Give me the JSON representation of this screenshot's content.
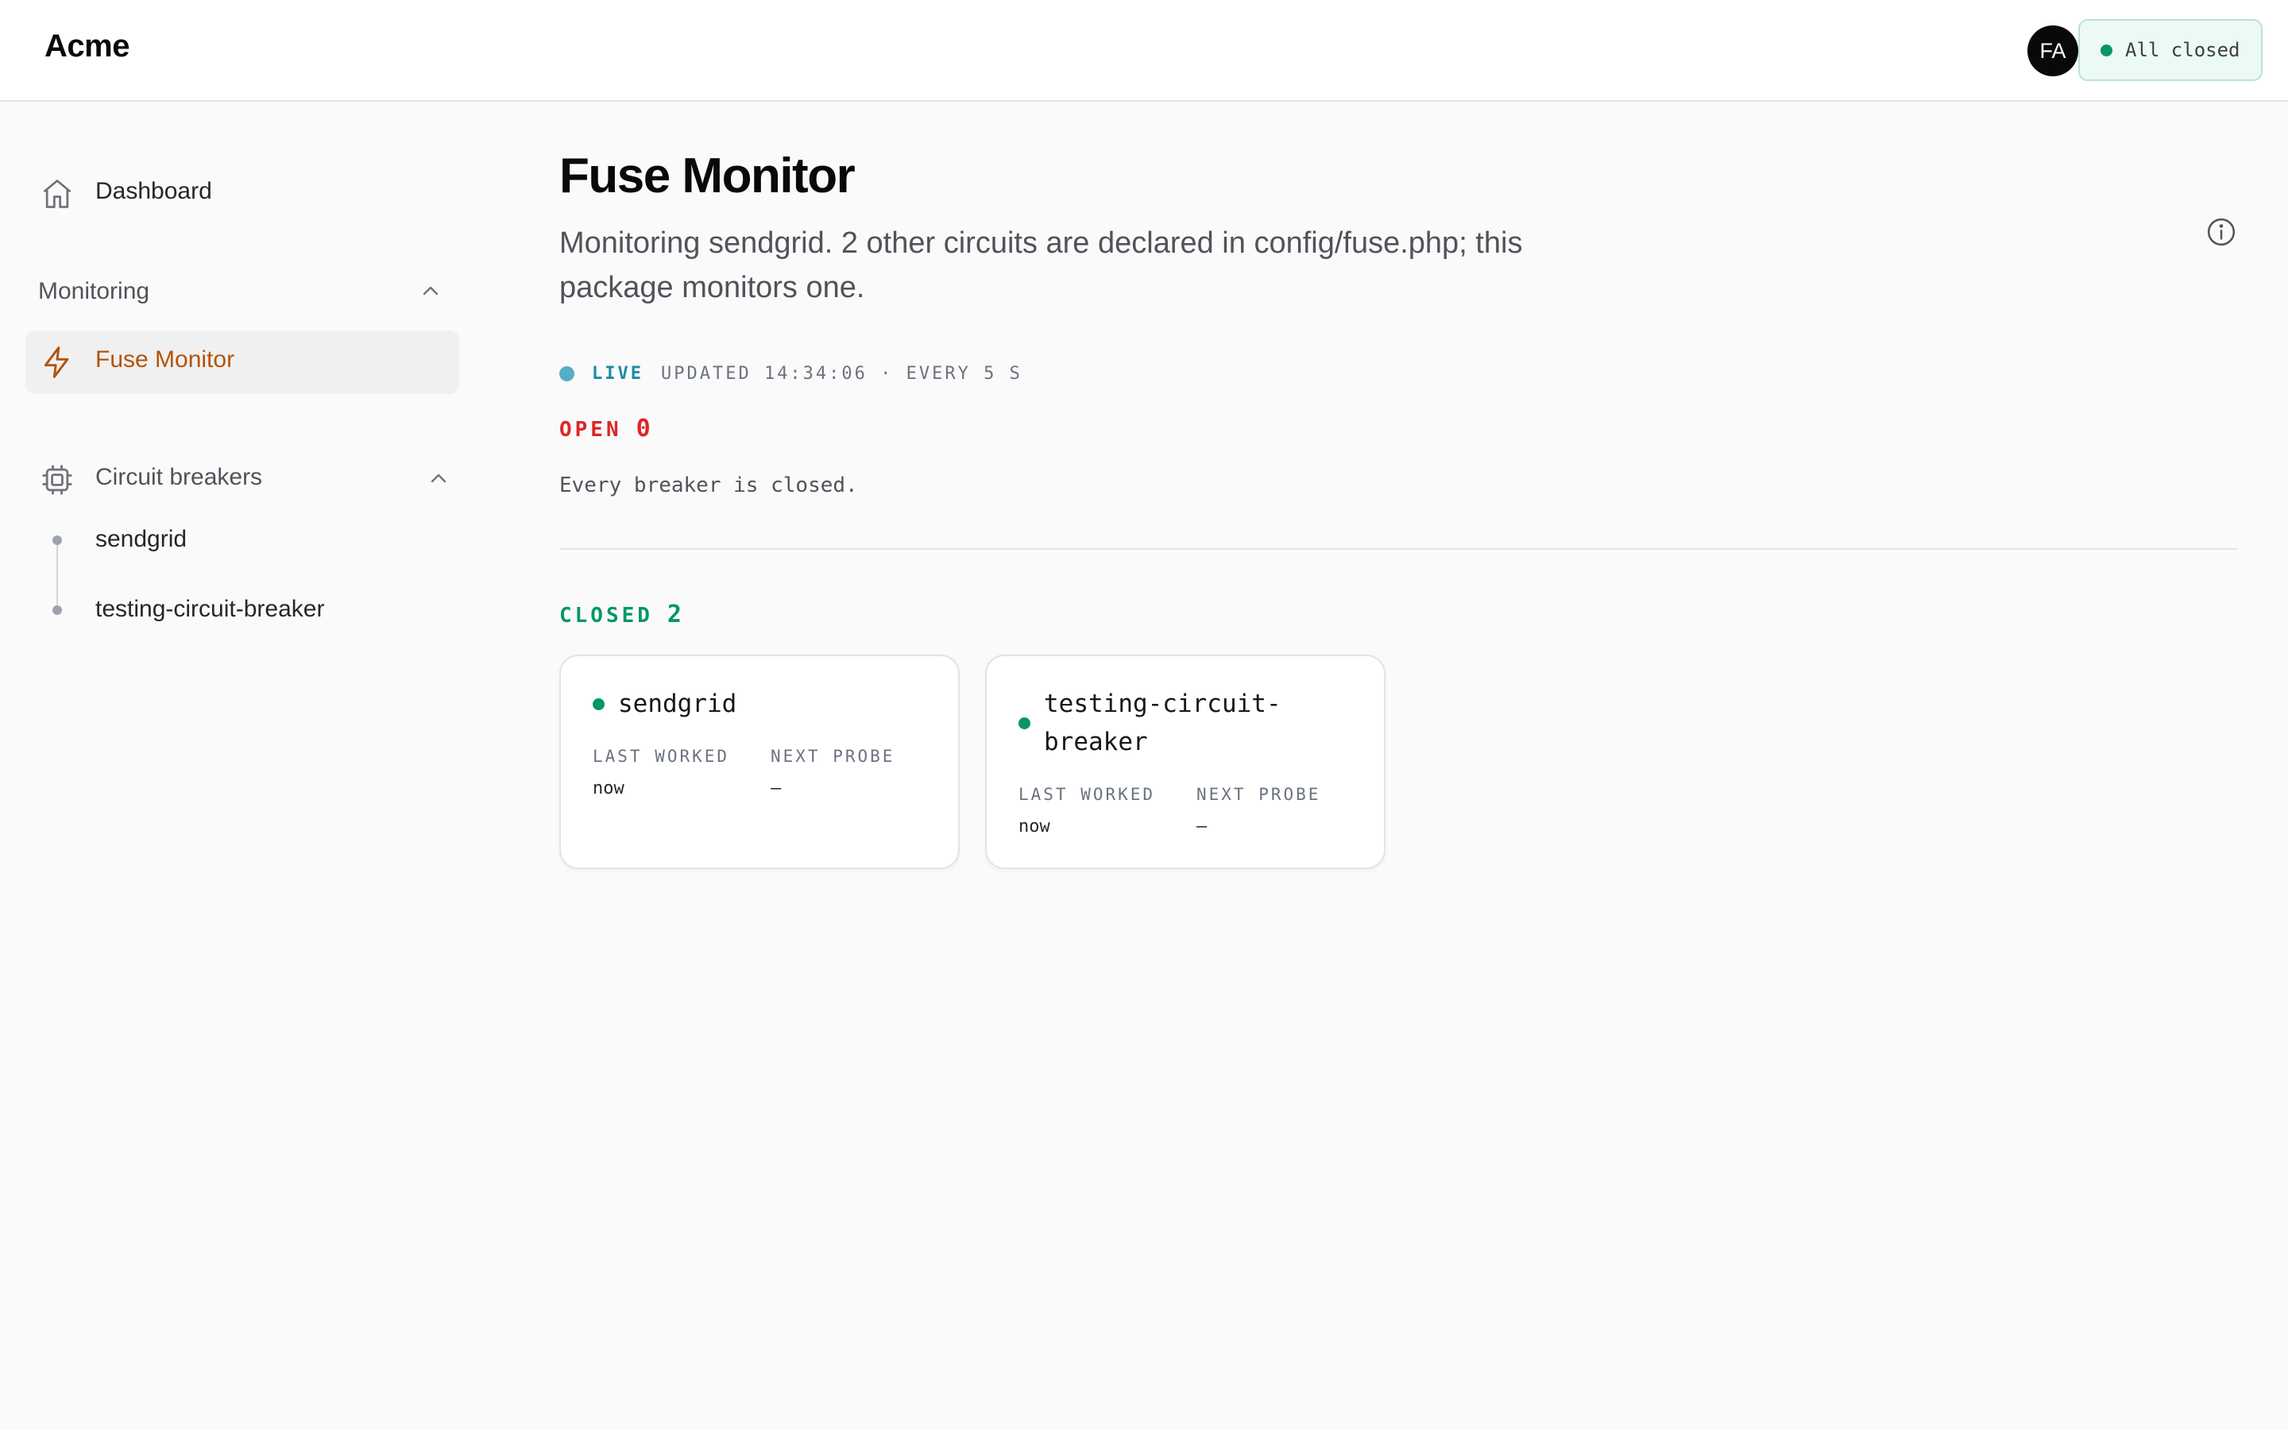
{
  "app": {
    "brand": "Acme"
  },
  "header": {
    "avatar_initials": "FA",
    "status_text": "All closed",
    "status_color": "#059669"
  },
  "sidebar": {
    "dashboard_label": "Dashboard",
    "dashboard_icon": "home-icon",
    "monitoring_group": {
      "label": "Monitoring",
      "items": [
        {
          "label": "Fuse Monitor",
          "icon": "bolt-icon",
          "active": true,
          "color": "#b45309"
        }
      ]
    },
    "breakers_group": {
      "label": "Circuit breakers",
      "icon": "chip-icon",
      "items": [
        {
          "label": "sendgrid"
        },
        {
          "label": "testing-circuit-breaker"
        }
      ]
    }
  },
  "main": {
    "title": "Fuse Monitor",
    "subtitle": "Monitoring sendgrid. 2 other circuits are declared in config/fuse.php; this package monitors one.",
    "info_icon": "info-icon",
    "live": {
      "label": "LIVE",
      "updated_text": "UPDATED 14:34:06 · EVERY 5 S"
    },
    "open_section": {
      "label": "OPEN",
      "count": "0",
      "empty_text": "Every breaker is closed."
    },
    "closed_section": {
      "label": "CLOSED",
      "count": "2",
      "cards": [
        {
          "name": "sendgrid",
          "last_worked_label": "LAST WORKED",
          "last_worked": "now",
          "next_probe_label": "NEXT PROBE",
          "next_probe": "—"
        },
        {
          "name": "testing-circuit-breaker",
          "last_worked_label": "LAST WORKED",
          "last_worked": "now",
          "next_probe_label": "NEXT PROBE",
          "next_probe": "—"
        }
      ]
    }
  }
}
